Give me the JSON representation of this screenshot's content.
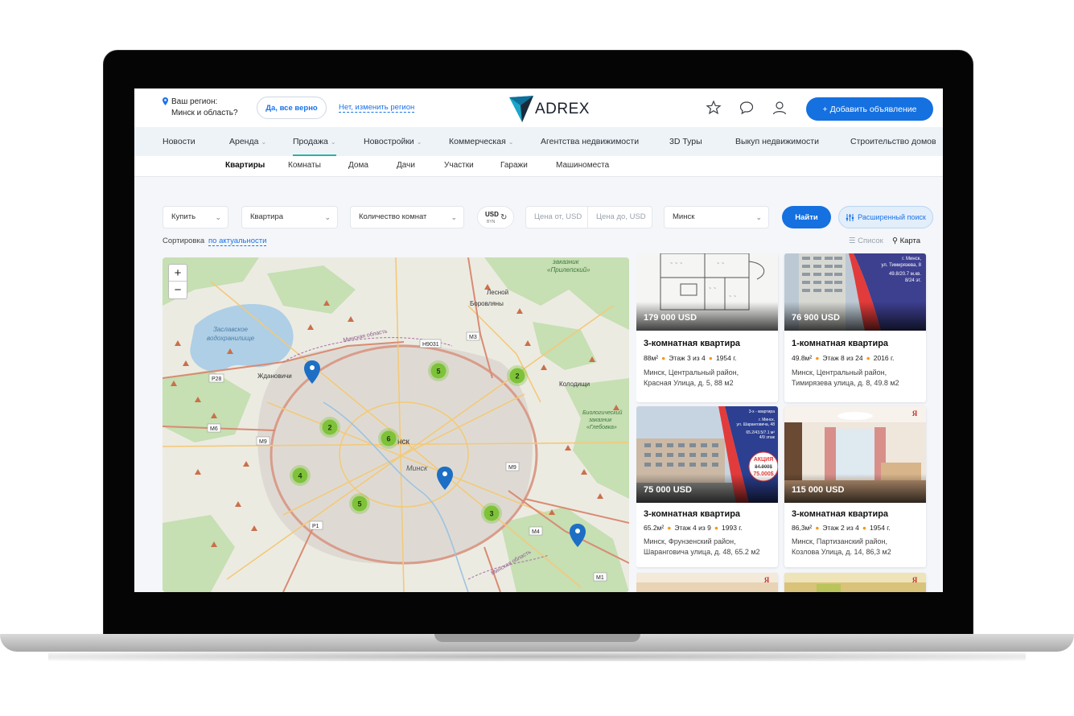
{
  "header": {
    "region_label": "Ваш регион:",
    "region_value": "Минск и область?",
    "confirm_button": "Да, все верно",
    "change_link": "Нет, изменить регион",
    "logo": "ADREX",
    "add_button": "+ Добавить объявление"
  },
  "nav": {
    "items": [
      {
        "label": "Новости"
      },
      {
        "label": "Аренда"
      },
      {
        "label": "Продажа"
      },
      {
        "label": "Новостройки"
      },
      {
        "label": "Коммерческая"
      },
      {
        "label": "Агентства недвижимости"
      },
      {
        "label": "3D Туры"
      },
      {
        "label": "Выкуп недвижимости"
      },
      {
        "label": "Строительство домов"
      }
    ],
    "active": "Продажа"
  },
  "subnav": {
    "items": [
      {
        "label": "Квартиры"
      },
      {
        "label": "Комнаты"
      },
      {
        "label": "Дома"
      },
      {
        "label": "Дачи"
      },
      {
        "label": "Участки"
      },
      {
        "label": "Гаражи"
      },
      {
        "label": "Машиноместа"
      }
    ],
    "active": "Квартиры"
  },
  "filters": {
    "deal": "Купить",
    "type": "Квартира",
    "rooms": "Количество комнат",
    "currency_top": "USD",
    "currency_bottom": "BYN",
    "price_from": "Цена от, USD",
    "price_to": "Цена до, USD",
    "city": "Минск",
    "find_button": "Найти",
    "advanced_button": "Расширенный поиск"
  },
  "sort": {
    "label": "Сортировка",
    "value": "по актуальности",
    "view_list": "Список",
    "view_map": "Карта"
  },
  "map": {
    "zoom_in": "+",
    "zoom_out": "−",
    "labels": {
      "reserve1": "заказник",
      "reserve2": "«Прилепский»",
      "lesnoy": "Лесной",
      "borovlyany": "Боровляны",
      "zaslavl1": "Заславское",
      "zaslavl2": "водохранилище",
      "oblast_top": "Минская область",
      "zhdanovichi": "Ждановичи",
      "kolodischi": "Колодищи",
      "bio1": "Биологический",
      "bio2": "заказник",
      "bio3": "«Глебовка»",
      "minsk_big": "нск",
      "minsk_italic": "Минск",
      "oblast_bottom": "Минская область",
      "roads": [
        "Н9031",
        "М3",
        "Р28",
        "М6",
        "М9",
        "М9",
        "Р1",
        "М4",
        "М1"
      ]
    },
    "clusters": [
      "5",
      "2",
      "2",
      "6",
      "4",
      "5",
      "3"
    ]
  },
  "listings": [
    {
      "price": "179 000 USD",
      "title": "3-комнатная квартира",
      "area": "88м²",
      "floor": "Этаж 3 из 4",
      "year": "1954 г.",
      "addr1": "Минск, Центральный район,",
      "addr2": "Красная Улица, д. 5, 88 м2"
    },
    {
      "price": "76 900 USD",
      "title": "1-комнатная квартира",
      "area": "49.8м²",
      "floor": "Этаж 8 из 24",
      "year": "2016 г.",
      "addr1": "Минск, Центральный район,",
      "addr2": "Тимирязева улица, д. 8, 49.8 м2"
    },
    {
      "price": "75 000 USD",
      "title": "3-комнатная квартира",
      "area": "65.2м²",
      "floor": "Этаж 4 из 9",
      "year": "1993 г.",
      "addr1": "Минск, Фрунзенский район,",
      "addr2": "Шаранговича улица, д. 48, 65.2 м2"
    },
    {
      "price": "115 000 USD",
      "title": "3-комнатная квартира",
      "area": "86,3м²",
      "floor": "Этаж 2 из 4",
      "year": "1954 г.",
      "addr1": "Минск, Партизанский район,",
      "addr2": "Козлова Улица, д. 14, 86,3 м2"
    }
  ],
  "banners": {
    "b2_line1": "г. Минск,",
    "b2_line2": "ул. Тимирязева, 8",
    "b2_line3": "49.8/20.7 м.кв.",
    "b2_line4": "8/24 эт.",
    "b3_line1": "3-х - квартира",
    "b3_line2": "г. Минск,",
    "b3_line3": "ул. Шаранговича, 48",
    "b3_line4": "65.2/43.5/7.1 м²",
    "b3_line5": "4/9 этаж",
    "b3_promo": "АКЦИЯ",
    "b3_old": "84.900$",
    "b3_new": "75.000$"
  },
  "colors": {
    "accent": "#1570e0",
    "cluster": "#7ec23a",
    "marker": "#1c6fc4",
    "dot": "#f39a1e"
  }
}
